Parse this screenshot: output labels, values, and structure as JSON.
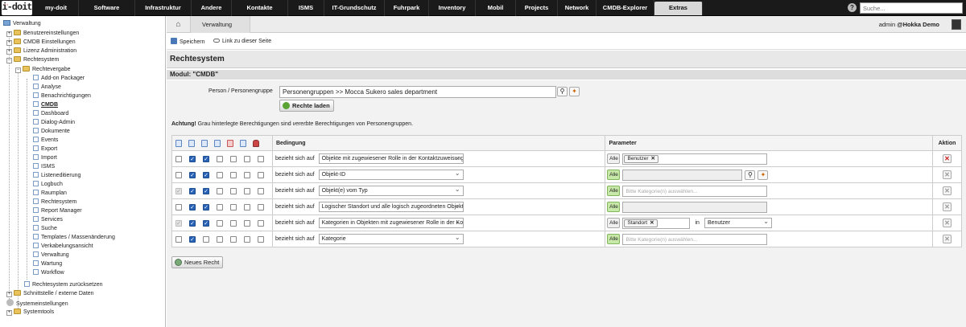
{
  "topnav": {
    "logo": "i-doit",
    "items": [
      "my-doit",
      "Software",
      "Infrastruktur",
      "Andere",
      "Kontakte",
      "ISMS",
      "IT-Grundschutz",
      "Fuhrpark",
      "Inventory",
      "Mobil",
      "Projects",
      "Network",
      "CMDB-Explorer",
      "Extras"
    ],
    "active": "Extras",
    "help": "?",
    "search_placeholder": "Suche..."
  },
  "sidebar": {
    "items": [
      {
        "label": "Verwaltung"
      },
      {
        "label": "Benutzereinstellungen"
      },
      {
        "label": "CMDB Einstellungen"
      },
      {
        "label": "Lizenz Administration"
      },
      {
        "label": "Rechtesystem"
      },
      {
        "label": "Rechtevergabe"
      },
      {
        "label": "Add-on Packager"
      },
      {
        "label": "Analyse"
      },
      {
        "label": "Benachrichtigungen"
      },
      {
        "label": "CMDB"
      },
      {
        "label": "Dashboard"
      },
      {
        "label": "Dialog-Admin"
      },
      {
        "label": "Dokumente"
      },
      {
        "label": "Events"
      },
      {
        "label": "Export"
      },
      {
        "label": "Import"
      },
      {
        "label": "ISMS"
      },
      {
        "label": "Listeneditierung"
      },
      {
        "label": "Logbuch"
      },
      {
        "label": "Raumplan"
      },
      {
        "label": "Rechtesystem"
      },
      {
        "label": "Report Manager"
      },
      {
        "label": "Services"
      },
      {
        "label": "Suche"
      },
      {
        "label": "Templates / Massenänderung"
      },
      {
        "label": "Verkabelungsansicht"
      },
      {
        "label": "Verwaltung"
      },
      {
        "label": "Wartung"
      },
      {
        "label": "Workflow"
      },
      {
        "label": "Rechtesystem zurücksetzen"
      },
      {
        "label": "Schnittstelle / externe Daten"
      },
      {
        "label": "Systemeinstellungen"
      },
      {
        "label": "Systemtools"
      }
    ]
  },
  "header": {
    "breadcrumb": "Verwaltung",
    "user": "admin",
    "tenant": "@Hokka Demo"
  },
  "toolbar": {
    "save": "Speichern",
    "link": "Link zu dieser Seite"
  },
  "page": {
    "title": "Rechtesystem",
    "module": "Modul: \"CMDB\""
  },
  "form": {
    "person_label": "Person / Personengruppe",
    "person_value": "Personengruppen >> Mocca Sukero sales department",
    "load_button": "Rechte laden",
    "warning_bold": "Achtung!",
    "warning_text": " Grau hinterlegte Berechtigungen sind ",
    "warning_italic": "vererbte",
    "warning_end": " Berechtigungen von Personengruppen."
  },
  "table": {
    "headers": {
      "condition": "Bedingung",
      "parameter": "Parameter",
      "action": "Aktion"
    },
    "rows": [
      {
        "checks": [
          "off",
          "on",
          "on",
          "off",
          "off",
          "off",
          "off"
        ],
        "refers": "bezieht sich auf",
        "condition": "Objekte mit zugewiesener Rolle in der Kontaktzuweisung",
        "alle": "Alle",
        "alle_green": false,
        "param_type": "tags",
        "tags": [
          "Benutzer"
        ],
        "placeholder": "",
        "in_text": "",
        "in_select": "",
        "delete_disabled": false
      },
      {
        "checks": [
          "off",
          "on",
          "on",
          "off",
          "off",
          "off",
          "off"
        ],
        "refers": "bezieht sich auf",
        "condition": "Objekt-ID",
        "alle": "Alle",
        "alle_green": true,
        "param_type": "search",
        "tags": [],
        "placeholder": "",
        "in_text": "",
        "in_select": "",
        "delete_disabled": true
      },
      {
        "checks": [
          "dis",
          "on",
          "on",
          "off",
          "off",
          "off",
          "off"
        ],
        "refers": "bezieht sich auf",
        "condition": "Objekt(e) vom Typ",
        "alle": "Alle",
        "alle_green": true,
        "param_type": "placeholder",
        "tags": [],
        "placeholder": "Bitte Kategorie(n) auswählen...",
        "in_text": "",
        "in_select": "",
        "delete_disabled": true
      },
      {
        "checks": [
          "off",
          "on",
          "on",
          "off",
          "off",
          "off",
          "off"
        ],
        "refers": "bezieht sich auf",
        "condition": "Logischer Standort und alle logisch zugeordneten Objekte",
        "alle": "Alle",
        "alle_green": true,
        "param_type": "gray",
        "tags": [],
        "placeholder": "",
        "in_text": "",
        "in_select": "",
        "delete_disabled": true
      },
      {
        "checks": [
          "dis",
          "on",
          "on",
          "off",
          "off",
          "off",
          "off"
        ],
        "refers": "bezieht sich auf",
        "condition": "Kategorien in Objekten mit zugewiesener Rolle in der Kontaktzuweisung",
        "alle": "Alle",
        "alle_green": false,
        "param_type": "in",
        "tags": [
          "Standort"
        ],
        "placeholder": "",
        "in_text": "in",
        "in_select": "Benutzer",
        "delete_disabled": true
      },
      {
        "checks": [
          "off",
          "on",
          "off",
          "off",
          "off",
          "off",
          "off"
        ],
        "refers": "bezieht sich auf",
        "condition": "Kategorie",
        "alle": "Alle",
        "alle_green": true,
        "param_type": "placeholder",
        "tags": [],
        "placeholder": "Bitte Kategorie(n) auswählen...",
        "in_text": "",
        "in_select": "",
        "delete_disabled": true
      }
    ]
  },
  "new_right": "Neues Recht",
  "colors": {
    "topbar": "#1a1a1a",
    "accent": "#2762b5",
    "green": "#5aa335",
    "delete": "#cc2222"
  }
}
